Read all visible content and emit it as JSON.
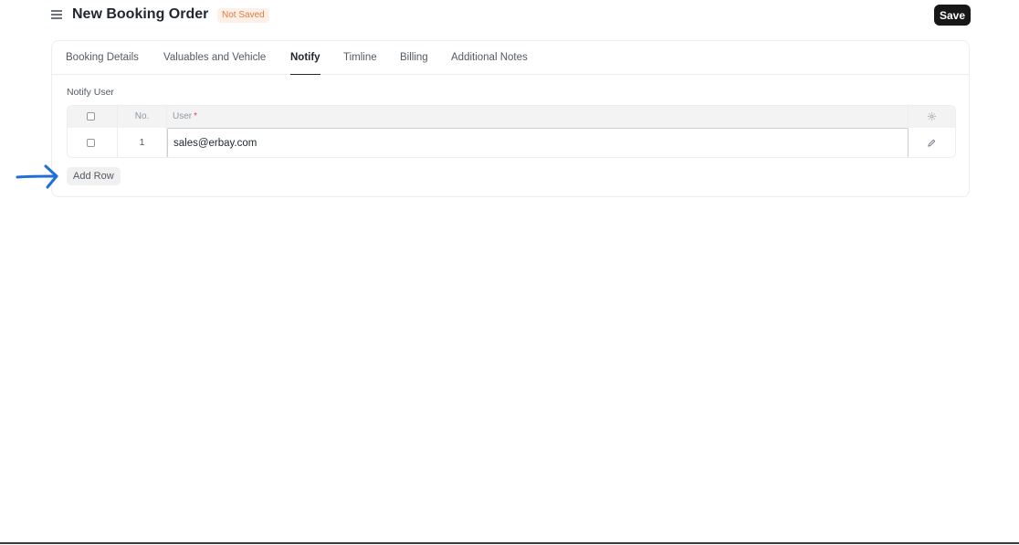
{
  "header": {
    "title": "New Booking Order",
    "status_badge": "Not Saved",
    "save_label": "Save"
  },
  "tabs": [
    {
      "label": "Booking Details",
      "active": false
    },
    {
      "label": "Valuables and Vehicle",
      "active": false
    },
    {
      "label": "Notify",
      "active": true
    },
    {
      "label": "Timline",
      "active": false
    },
    {
      "label": "Billing",
      "active": false
    },
    {
      "label": "Additional Notes",
      "active": false
    }
  ],
  "notify": {
    "field_label": "Notify User",
    "columns": {
      "no": "No.",
      "user": "User",
      "required_mark": "*"
    },
    "rows": [
      {
        "no": "1",
        "user": "sales@erbay.com"
      }
    ],
    "add_row_label": "Add Row"
  },
  "colors": {
    "primary_button": "#171717",
    "badge_text": "#e07b39",
    "badge_bg": "#fdf0e8",
    "annotation_arrow": "#1f6fd6"
  },
  "icons": {
    "menu": "hamburger-icon",
    "settings": "gear-icon",
    "edit": "pencil-icon",
    "annotation": "arrow-annotation-icon"
  }
}
